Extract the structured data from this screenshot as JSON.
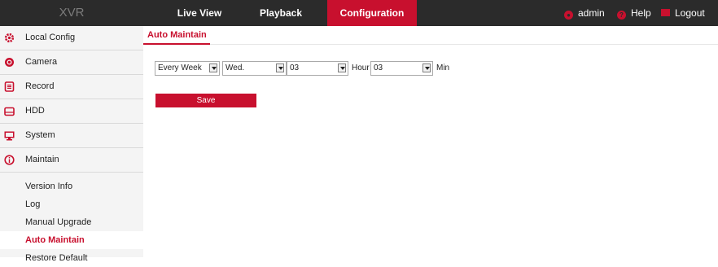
{
  "app": {
    "logo": "XVR"
  },
  "nav": {
    "live_view": "Live View",
    "playback": "Playback",
    "configuration": "Configuration"
  },
  "user": {
    "admin": "admin",
    "help": "Help",
    "logout": "Logout"
  },
  "sidebar": {
    "items": [
      {
        "label": "Local Config",
        "icon": "gear-icon"
      },
      {
        "label": "Camera",
        "icon": "camera-icon"
      },
      {
        "label": "Record",
        "icon": "record-icon"
      },
      {
        "label": "HDD",
        "icon": "hdd-icon"
      },
      {
        "label": "System",
        "icon": "monitor-icon"
      },
      {
        "label": "Maintain",
        "icon": "info-icon"
      }
    ],
    "sub_items": [
      {
        "label": "Version Info"
      },
      {
        "label": "Log"
      },
      {
        "label": "Manual Upgrade"
      },
      {
        "label": "Auto Maintain",
        "active": true
      },
      {
        "label": "Restore Default"
      }
    ]
  },
  "main": {
    "tab_title": "Auto Maintain",
    "frequency": "Every Week",
    "day": "Wed.",
    "hour": "03",
    "hour_unit": "Hour",
    "minute": "03",
    "minute_unit": "Min",
    "save_label": "Save"
  },
  "colors": {
    "accent": "#c8102e",
    "topbar": "#2b2b2b",
    "sidebar": "#f4f4f4"
  }
}
